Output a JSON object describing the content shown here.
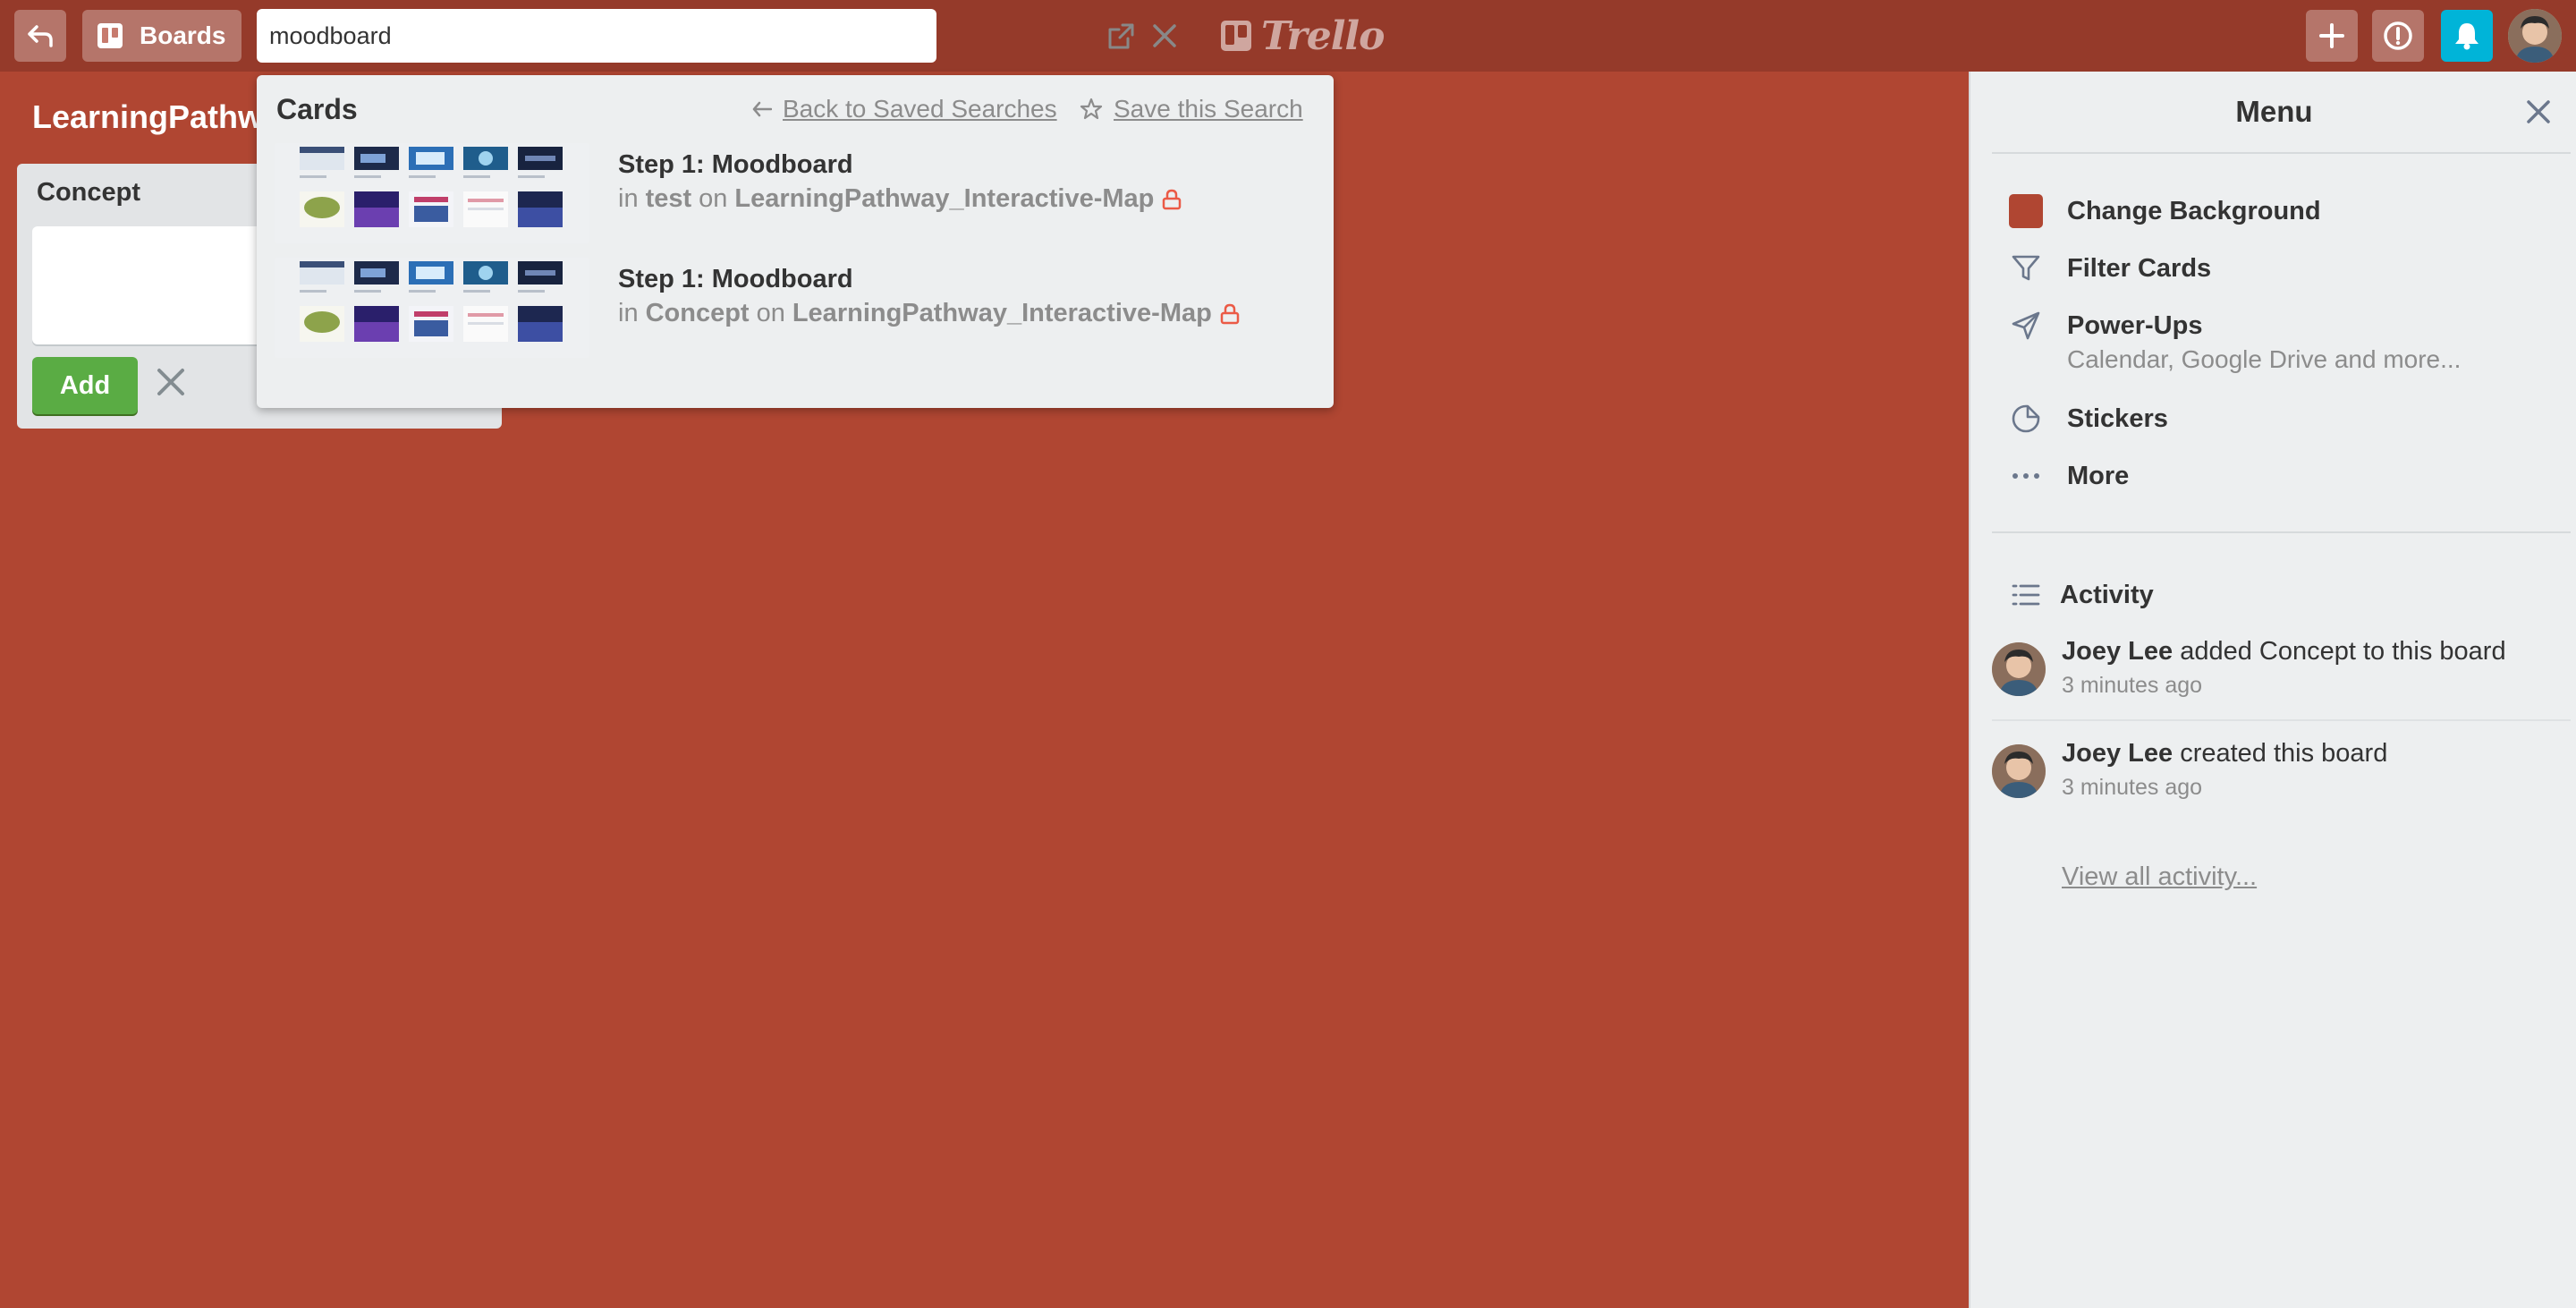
{
  "header": {
    "back_icon": "back-arrow-icon",
    "boards_label": "Boards",
    "search": {
      "value": "moodboard",
      "placeholder": ""
    },
    "logo_text": "Trello",
    "colors": {
      "header_bg": "#953a2a",
      "bell_bg": "#00b4d8"
    }
  },
  "board": {
    "title": "LearningPathway_Interactive-Map",
    "background_color": "#b04632",
    "list": {
      "title": "Concept",
      "add_label": "Add"
    }
  },
  "search_popover": {
    "title": "Cards",
    "back_label": "Back to Saved Searches",
    "save_label": "Save this Search",
    "results": [
      {
        "name": "Step 1: Moodboard",
        "in_word": "in",
        "list": "test",
        "on_word": "on",
        "board": "LearningPathway_Interactive-Map",
        "private_icon": "lock-icon"
      },
      {
        "name": "Step 1: Moodboard",
        "in_word": "in",
        "list": "Concept",
        "on_word": "on",
        "board": "LearningPathway_Interactive-Map",
        "private_icon": "lock-icon"
      }
    ]
  },
  "sidebar": {
    "title": "Menu",
    "items": [
      {
        "label": "Change Background",
        "icon": "color-swatch-icon"
      },
      {
        "label": "Filter Cards",
        "icon": "filter-icon"
      },
      {
        "label": "Power-Ups",
        "icon": "rocket-icon",
        "sub": "Calendar, Google Drive and more..."
      },
      {
        "label": "Stickers",
        "icon": "sticker-icon"
      },
      {
        "label": "More",
        "icon": "ellipsis-icon"
      }
    ],
    "activity": {
      "title": "Activity",
      "entries": [
        {
          "user": "Joey Lee",
          "action": "added Concept to this board",
          "time": "3 minutes ago"
        },
        {
          "user": "Joey Lee",
          "action": "created this board",
          "time": "3 minutes ago"
        }
      ],
      "view_all": "View all activity..."
    }
  }
}
